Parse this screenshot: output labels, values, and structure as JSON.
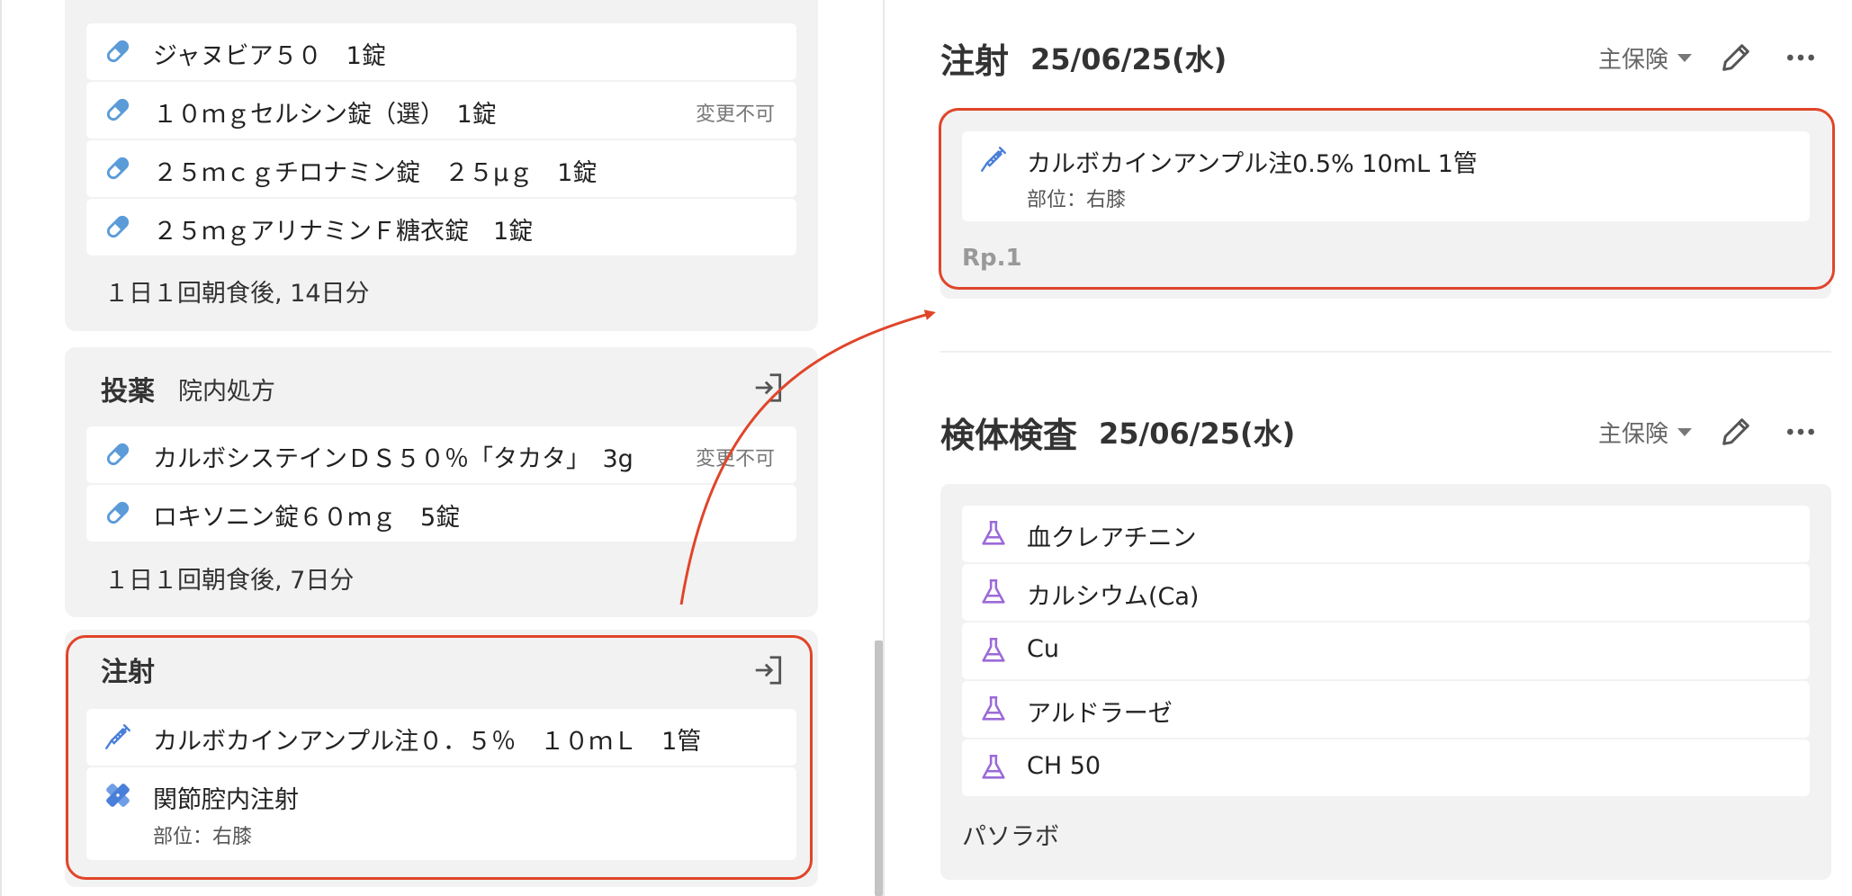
{
  "left": {
    "card1": {
      "items": [
        {
          "label": "ジャヌビア５０　1錠",
          "badge": ""
        },
        {
          "label": "１０ｍｇセルシン錠（選）　1錠",
          "badge": "変更不可"
        },
        {
          "label": "２５ｍｃｇチロナミン錠　２５μｇ　1錠",
          "badge": ""
        },
        {
          "label": "２５ｍｇアリナミンＦ糖衣錠　1錠",
          "badge": ""
        }
      ],
      "footer": "１日１回朝食後, 14日分"
    },
    "card2": {
      "title": "投薬",
      "subtitle": "院内処方",
      "items": [
        {
          "label": "カルボシステインＤＳ５０％「タカタ」　3g",
          "badge": "変更不可"
        },
        {
          "label": "ロキソニン錠６０ｍｇ　5錠",
          "badge": ""
        }
      ],
      "footer": "１日１回朝食後, 7日分"
    },
    "card3": {
      "title": "注射",
      "items": [
        {
          "label": "カルボカインアンプル注０．５％　１０ｍＬ　1管",
          "sub": ""
        },
        {
          "label": "関節腔内注射",
          "sub": "部位：右膝"
        }
      ]
    }
  },
  "right": {
    "injection": {
      "title": "注射",
      "date": "25/06/25(水)",
      "insurance": "主保険",
      "item": {
        "label": "カルボカインアンプル注0.5% 10mL  1管",
        "sub": "部位：右膝"
      },
      "rp": "Rp.1"
    },
    "lab": {
      "title": "検体検査",
      "date": "25/06/25(水)",
      "insurance": "主保険",
      "items": [
        "血クレアチニン",
        "カルシウム(Ca)",
        "Cu",
        "アルドラーゼ",
        "CH 50"
      ],
      "footer": "パソラボ"
    }
  },
  "colors": {
    "pill": "#5b9bd8",
    "syringe": "#4a7fd9",
    "flask": "#9b6ad8",
    "highlight": "#e0452a",
    "card_bg": "#f2f2f2"
  },
  "icons": {
    "pill": "pill-icon",
    "syringe": "syringe-icon",
    "procedure": "bandage-icon",
    "flask": "flask-icon",
    "import": "import-icon",
    "edit": "pencil-icon",
    "more": "more-icon"
  }
}
